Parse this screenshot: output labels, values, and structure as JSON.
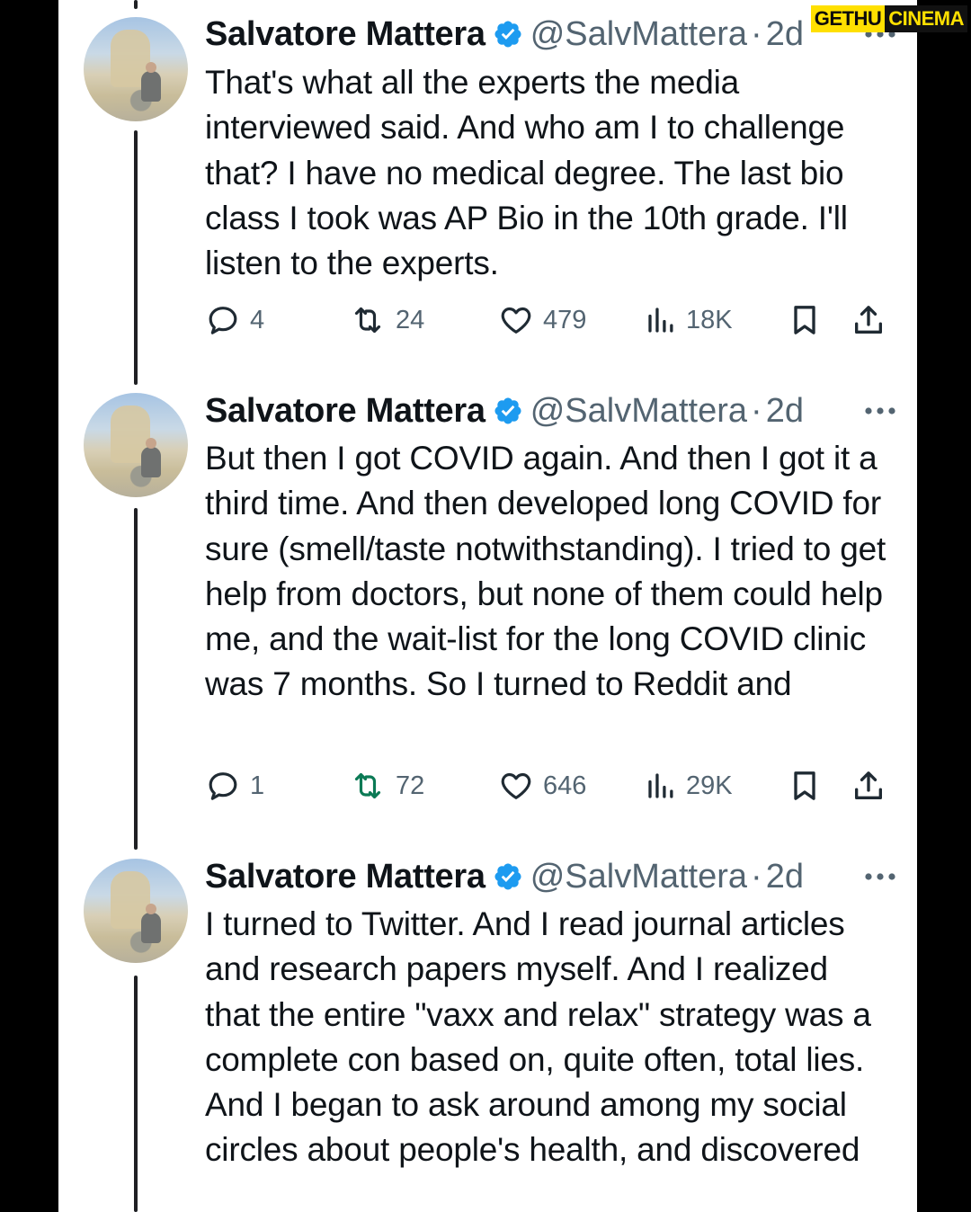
{
  "watermark": {
    "part1": "GETHU",
    "part2": "CINEMA"
  },
  "colors": {
    "verified": "#1d9bf0",
    "text": "#0f1419",
    "muted": "#536471",
    "background": "#ffffff"
  },
  "tweets": [
    {
      "name": "Salvatore Mattera",
      "handle": "@SalvMattera",
      "separator": "·",
      "time": "2d",
      "text": "That's what all the experts the media interviewed said. And who am I to challenge that? I have no medical degree. The last bio class I took was AP Bio in the 10th grade. I'll listen to the experts.",
      "replies": "4",
      "reposts": "24",
      "likes": "479",
      "views": "18K"
    },
    {
      "name": "Salvatore Mattera",
      "handle": "@SalvMattera",
      "separator": "·",
      "time": "2d",
      "text": "But then I got COVID again. And then I got it a third time. And then developed long COVID for sure (smell/taste notwithstanding). I tried to get help from doctors, but none of them could help me, and the wait-list for the long COVID clinic was 7 months. So I turned to Reddit and",
      "replies": "1",
      "reposts": "72",
      "likes": "646",
      "views": "29K"
    },
    {
      "name": "Salvatore Mattera",
      "handle": "@SalvMattera",
      "separator": "·",
      "time": "2d",
      "text": "I turned to Twitter. And I read journal articles and research papers myself. And I realized that the entire \"vaxx and relax\" strategy was a complete con based on, quite often, total lies. And I began to ask around among my social circles about people's health, and discovered"
    }
  ]
}
